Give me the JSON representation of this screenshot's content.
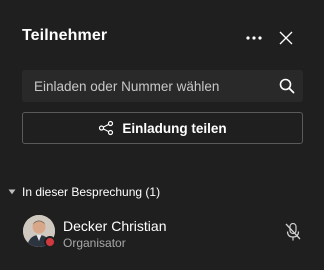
{
  "header": {
    "title": "Teilnehmer",
    "more_icon": "more-horizontal-icon",
    "close_icon": "close-icon"
  },
  "search": {
    "placeholder": "Einladen oder Nummer wählen",
    "value": "",
    "icon": "search-icon"
  },
  "share_button": {
    "label": "Einladung teilen",
    "icon": "share-icon"
  },
  "section": {
    "label": "In dieser Besprechung (1)",
    "expanded": true
  },
  "participants": [
    {
      "name": "Decker Christian",
      "role": "Organisator",
      "status_color": "#d03a3f",
      "mic_icon": "mic-off-icon"
    }
  ],
  "colors": {
    "background": "#1f1f1f",
    "input_background": "#292929",
    "button_border": "#5a5a5a",
    "secondary_text": "#a8a8a8"
  }
}
